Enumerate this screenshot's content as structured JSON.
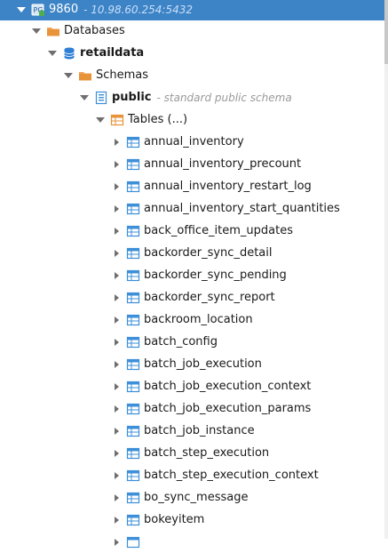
{
  "connection": {
    "name": "9860",
    "host": "- 10.98.60.254:5432"
  },
  "nodes": {
    "databases": "Databases",
    "database": "retaildata",
    "schemas": "Schemas",
    "schema": "public",
    "schema_desc": "- standard public schema",
    "tables": "Tables (...)"
  },
  "tables": [
    "annual_inventory",
    "annual_inventory_precount",
    "annual_inventory_restart_log",
    "annual_inventory_start_quantities",
    "back_office_item_updates",
    "backorder_sync_detail",
    "backorder_sync_pending",
    "backorder_sync_report",
    "backroom_location",
    "batch_config",
    "batch_job_execution",
    "batch_job_execution_context",
    "batch_job_execution_params",
    "batch_job_instance",
    "batch_step_execution",
    "batch_step_execution_context",
    "bo_sync_message",
    "bokeyitem"
  ],
  "colors": {
    "selection": "#3d84c6",
    "folder": "#e8923a",
    "database": "#2f7fd4",
    "table": "#3c8fd8"
  },
  "icons": {
    "connection": "postgres-connection-icon",
    "databases": "folder-icon",
    "database": "database-icon",
    "schemas": "folder-icon",
    "schema": "schema-icon",
    "tables": "tables-folder-icon",
    "table": "table-icon"
  }
}
